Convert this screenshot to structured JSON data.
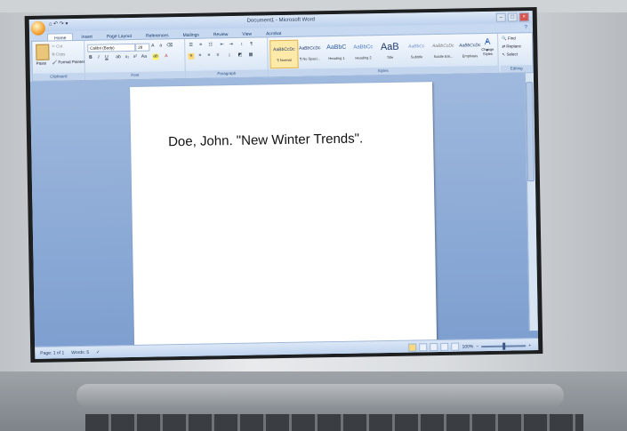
{
  "window": {
    "title": "Document1 - Microsoft Word",
    "quick_access": "⌂ ↶ ↷ ▾"
  },
  "tabs": [
    "Home",
    "Insert",
    "Page Layout",
    "References",
    "Mailings",
    "Review",
    "View",
    "Acrobat"
  ],
  "ribbon": {
    "clipboard": {
      "label": "Clipboard",
      "paste": "Paste",
      "cut": "Cut",
      "copy": "Copy",
      "format_painter": "Format Painter"
    },
    "font": {
      "label": "Font",
      "font_name": "Calibri (Body)",
      "font_size": "28",
      "bold": "B",
      "italic": "I",
      "underline": "U"
    },
    "paragraph": {
      "label": "Paragraph"
    },
    "styles": {
      "label": "Styles",
      "items": [
        {
          "preview": "AaBbCcDc",
          "name": "¶ Normal"
        },
        {
          "preview": "AaBbCcDc",
          "name": "¶ No Spaci..."
        },
        {
          "preview": "AaBbC",
          "name": "Heading 1"
        },
        {
          "preview": "AaBbCc",
          "name": "Heading 2"
        },
        {
          "preview": "AaB",
          "name": "Title"
        },
        {
          "preview": "AaBbCc",
          "name": "Subtitle"
        },
        {
          "preview": "AaBbCcDc",
          "name": "Subtle Em..."
        },
        {
          "preview": "AaBbCcDc",
          "name": "Emphasis"
        }
      ],
      "change_styles": "Change Styles"
    },
    "editing": {
      "label": "Editing",
      "find": "Find",
      "replace": "Replace",
      "select": "Select"
    }
  },
  "document": {
    "text": "Doe, John. \"New Winter Trends\"."
  },
  "status": {
    "page": "Page: 1 of 1",
    "words": "Words: 5",
    "zoom": "100%"
  }
}
